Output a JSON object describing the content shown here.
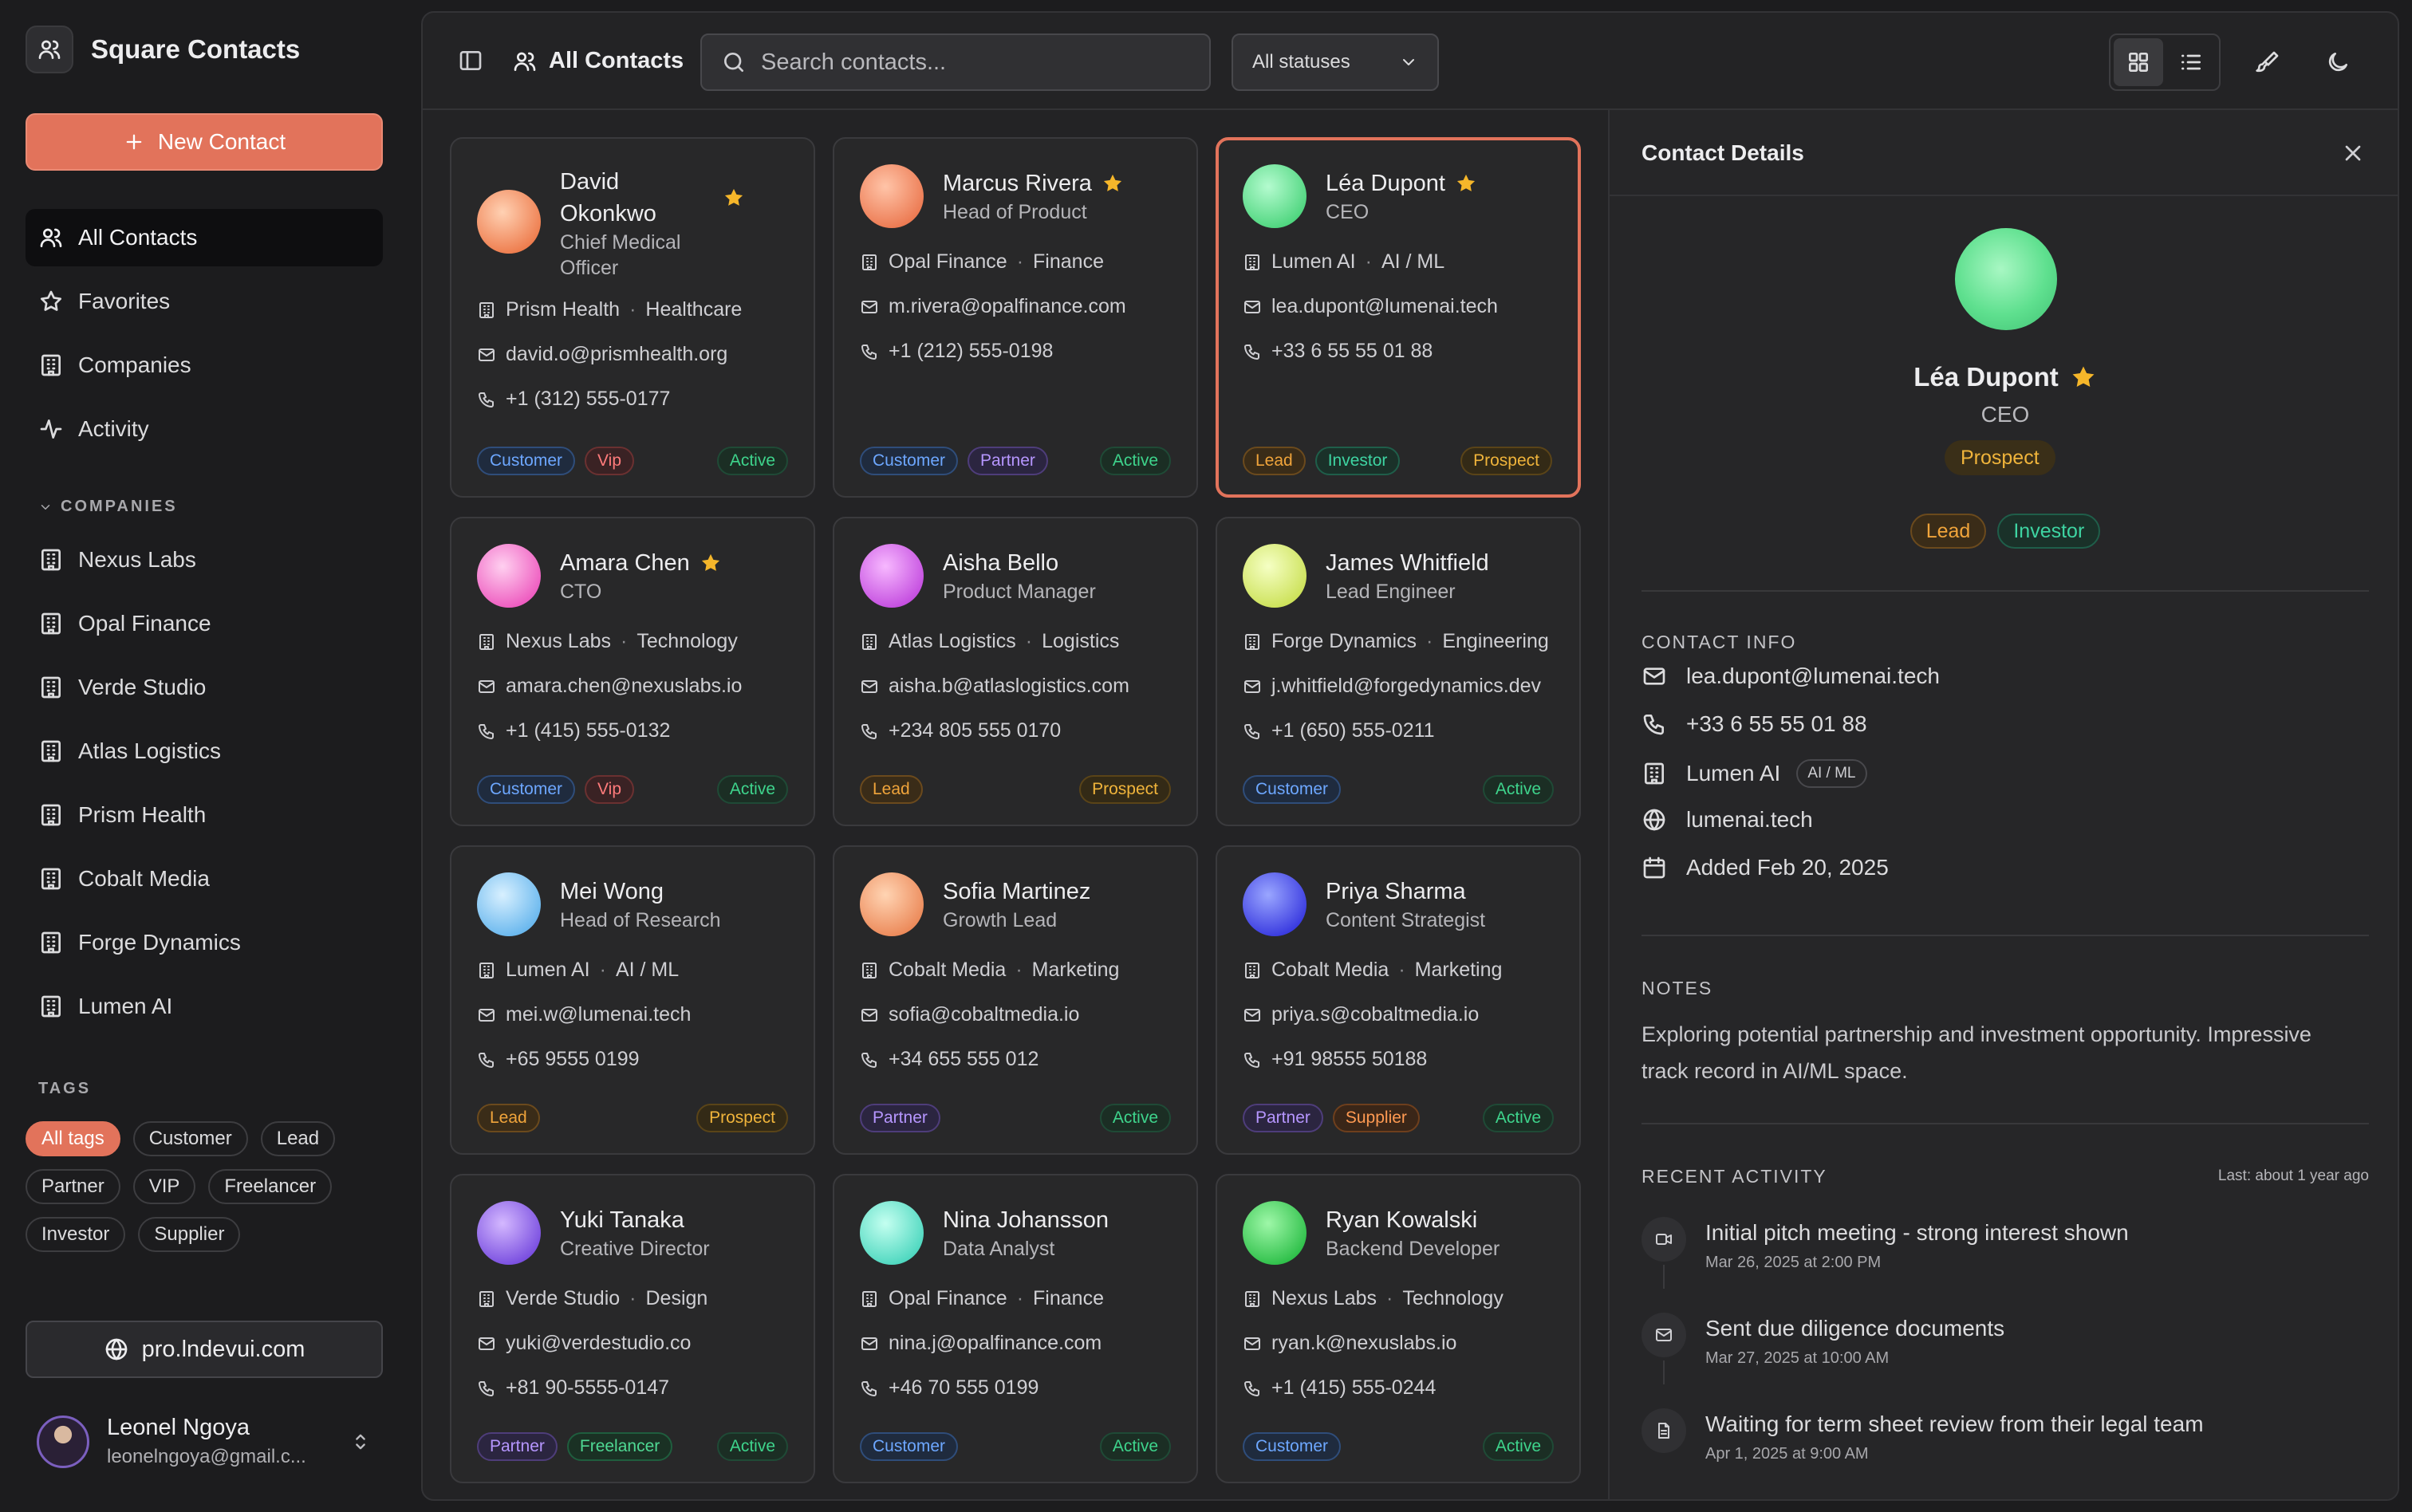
{
  "app": {
    "name": "Square Contacts"
  },
  "sidebar": {
    "new_contact_label": "New Contact",
    "nav": [
      {
        "label": "All Contacts",
        "icon": "users-icon",
        "active": true
      },
      {
        "label": "Favorites",
        "icon": "star-icon",
        "active": false
      },
      {
        "label": "Companies",
        "icon": "building-icon",
        "active": false
      },
      {
        "label": "Activity",
        "icon": "activity-icon",
        "active": false
      }
    ],
    "companies_label": "COMPANIES",
    "companies": [
      "Nexus Labs",
      "Opal Finance",
      "Verde Studio",
      "Atlas Logistics",
      "Prism Health",
      "Cobalt Media",
      "Forge Dynamics",
      "Lumen AI"
    ],
    "tags_label": "TAGS",
    "tags": [
      {
        "label": "All tags",
        "active": true
      },
      {
        "label": "Customer",
        "active": false
      },
      {
        "label": "Lead",
        "active": false
      },
      {
        "label": "Partner",
        "active": false
      },
      {
        "label": "VIP",
        "active": false
      },
      {
        "label": "Freelancer",
        "active": false
      },
      {
        "label": "Investor",
        "active": false
      },
      {
        "label": "Supplier",
        "active": false
      }
    ],
    "site_link": "pro.lndevui.com",
    "user": {
      "name": "Leonel Ngoya",
      "email": "leonelngoya@gmail.c..."
    }
  },
  "topbar": {
    "title": "All Contacts",
    "search_placeholder": "Search contacts...",
    "status_filter": "All statuses"
  },
  "contacts": [
    {
      "name": "David Okonkwo",
      "favorite": true,
      "role": "Chief Medical Officer",
      "company": "Prism Health",
      "industry": "Healthcare",
      "email": "david.o@prismhealth.org",
      "phone": "+1 (312) 555-0177",
      "tags": [
        "Customer",
        "Vip"
      ],
      "status": "Active",
      "avatar": [
        "#ffd1b3",
        "#ee7d4e"
      ]
    },
    {
      "name": "Marcus Rivera",
      "favorite": true,
      "role": "Head of Product",
      "company": "Opal Finance",
      "industry": "Finance",
      "email": "m.rivera@opalfinance.com",
      "phone": "+1 (212) 555-0198",
      "tags": [
        "Customer",
        "Partner"
      ],
      "status": "Active",
      "avatar": [
        "#ffc4a8",
        "#ec7a52"
      ]
    },
    {
      "name": "Léa Dupont",
      "favorite": true,
      "role": "CEO",
      "company": "Lumen AI",
      "industry": "AI / ML",
      "email": "lea.dupont@lumenai.tech",
      "phone": "+33 6 55 55 01 88",
      "tags": [
        "Lead",
        "Investor"
      ],
      "status": "Prospect",
      "avatar": [
        "#b4fbcf",
        "#4fd67f"
      ],
      "selected": true
    },
    {
      "name": "Amara Chen",
      "favorite": true,
      "role": "CTO",
      "company": "Nexus Labs",
      "industry": "Technology",
      "email": "amara.chen@nexuslabs.io",
      "phone": "+1 (415) 555-0132",
      "tags": [
        "Customer",
        "Vip"
      ],
      "status": "Active",
      "avatar": [
        "#ffd0f0",
        "#ee5cc0"
      ]
    },
    {
      "name": "Aisha Bello",
      "favorite": false,
      "role": "Product Manager",
      "company": "Atlas Logistics",
      "industry": "Logistics",
      "email": "aisha.b@atlaslogistics.com",
      "phone": "+234 805 555 0170",
      "tags": [
        "Lead"
      ],
      "status": "Prospect",
      "avatar": [
        "#f7b8ff",
        "#c54fe0"
      ]
    },
    {
      "name": "James Whitfield",
      "favorite": false,
      "role": "Lead Engineer",
      "company": "Forge Dynamics",
      "industry": "Engineering",
      "email": "j.whitfield@forgedynamics.dev",
      "phone": "+1 (650) 555-0211",
      "tags": [
        "Customer"
      ],
      "status": "Active",
      "avatar": [
        "#f5ffc4",
        "#cde25a"
      ]
    },
    {
      "name": "Mei Wong",
      "favorite": false,
      "role": "Head of Research",
      "company": "Lumen AI",
      "industry": "AI / ML",
      "email": "mei.w@lumenai.tech",
      "phone": "+65 9555 0199",
      "tags": [
        "Lead"
      ],
      "status": "Prospect",
      "avatar": [
        "#d8f0ff",
        "#6ab8ee"
      ]
    },
    {
      "name": "Sofia Martinez",
      "favorite": false,
      "role": "Growth Lead",
      "company": "Cobalt Media",
      "industry": "Marketing",
      "email": "sofia@cobaltmedia.io",
      "phone": "+34 655 555 012",
      "tags": [
        "Partner"
      ],
      "status": "Active",
      "avatar": [
        "#ffd4b3",
        "#ec8a5a"
      ]
    },
    {
      "name": "Priya Sharma",
      "favorite": false,
      "role": "Content Strategist",
      "company": "Cobalt Media",
      "industry": "Marketing",
      "email": "priya.s@cobaltmedia.io",
      "phone": "+91 98555 50188",
      "tags": [
        "Partner",
        "Supplier"
      ],
      "status": "Active",
      "avatar": [
        "#9aa6ff",
        "#3a3be0"
      ]
    },
    {
      "name": "Yuki Tanaka",
      "favorite": false,
      "role": "Creative Director",
      "company": "Verde Studio",
      "industry": "Design",
      "email": "yuki@verdestudio.co",
      "phone": "+81 90-5555-0147",
      "tags": [
        "Partner",
        "Freelancer"
      ],
      "status": "Active",
      "avatar": [
        "#d4b8ff",
        "#7a4fe0"
      ]
    },
    {
      "name": "Nina Johansson",
      "favorite": false,
      "role": "Data Analyst",
      "company": "Opal Finance",
      "industry": "Finance",
      "email": "nina.j@opalfinance.com",
      "phone": "+46 70 555 0199",
      "tags": [
        "Customer"
      ],
      "status": "Active",
      "avatar": [
        "#c4fff0",
        "#4fd8c0"
      ]
    },
    {
      "name": "Ryan Kowalski",
      "favorite": false,
      "role": "Backend Developer",
      "company": "Nexus Labs",
      "industry": "Technology",
      "email": "ryan.k@nexuslabs.io",
      "phone": "+1 (415) 555-0244",
      "tags": [
        "Customer"
      ],
      "status": "Active",
      "avatar": [
        "#9ef7a8",
        "#2fc04a"
      ]
    }
  ],
  "detail": {
    "title": "Contact Details",
    "name": "Léa Dupont",
    "role": "CEO",
    "status": "Prospect",
    "tags": [
      "Lead",
      "Investor"
    ],
    "contact_info_label": "CONTACT INFO",
    "email": "lea.dupont@lumenai.tech",
    "phone": "+33 6 55 55 01 88",
    "company": "Lumen AI",
    "industry": "AI / ML",
    "website": "lumenai.tech",
    "added": "Added Feb 20, 2025",
    "notes_label": "NOTES",
    "notes": "Exploring potential partnership and investment opportunity. Impressive track record in AI/ML space.",
    "activity_label": "RECENT ACTIVITY",
    "activity_last": "Last: about 1 year ago",
    "activities": [
      {
        "icon": "video-icon",
        "text": "Initial pitch meeting - strong interest shown",
        "time": "Mar 26, 2025 at 2:00 PM"
      },
      {
        "icon": "mail-icon",
        "text": "Sent due diligence documents",
        "time": "Mar 27, 2025 at 10:00 AM"
      },
      {
        "icon": "document-icon",
        "text": "Waiting for term sheet review from their legal team",
        "time": "Apr 1, 2025 at 9:00 AM"
      }
    ]
  }
}
